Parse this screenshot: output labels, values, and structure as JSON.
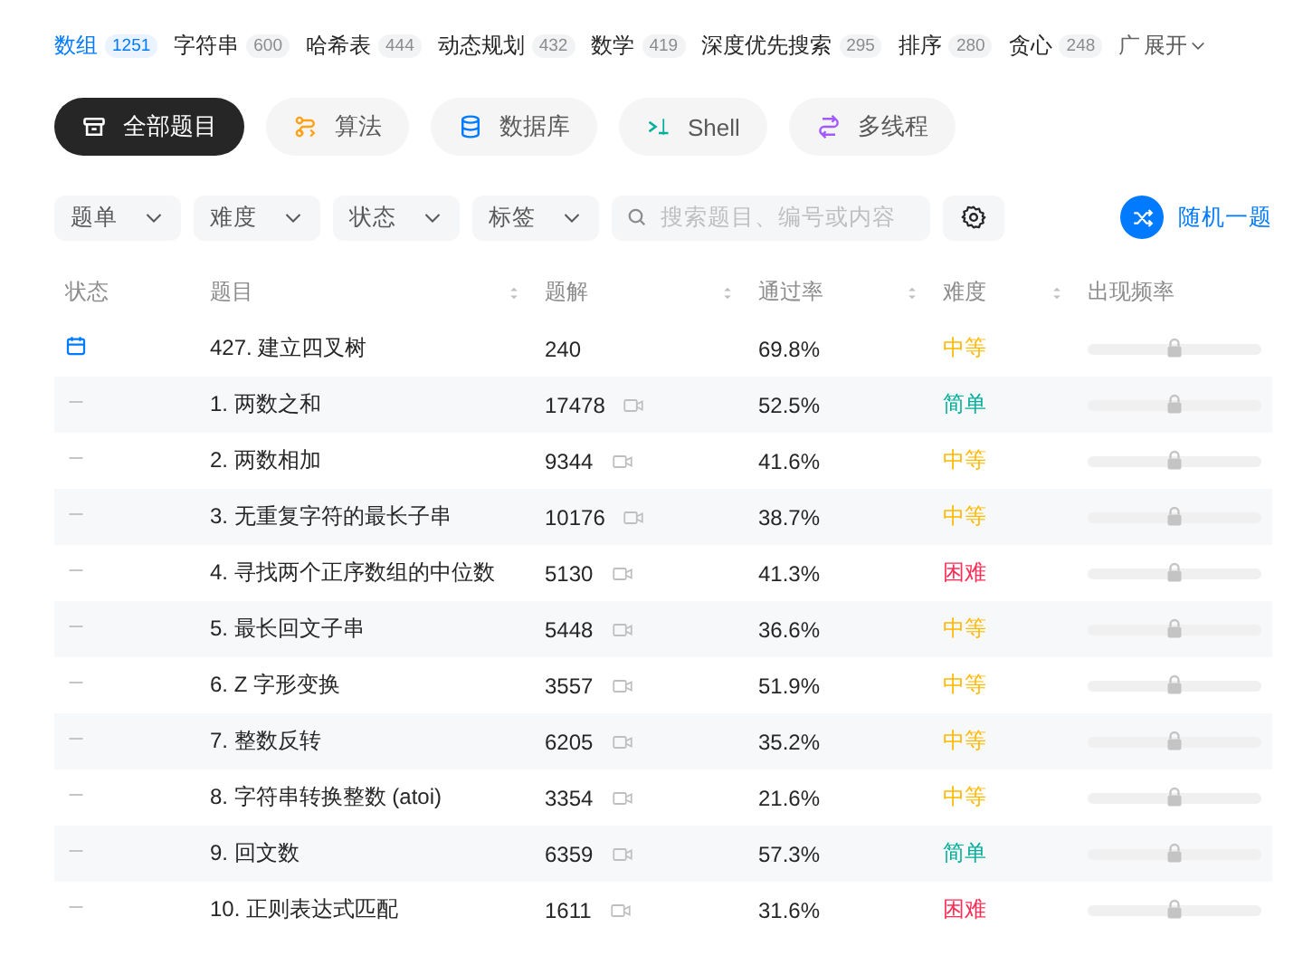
{
  "tags": [
    {
      "label": "数组",
      "count": "1251",
      "selected": true
    },
    {
      "label": "字符串",
      "count": "600",
      "selected": false
    },
    {
      "label": "哈希表",
      "count": "444",
      "selected": false
    },
    {
      "label": "动态规划",
      "count": "432",
      "selected": false
    },
    {
      "label": "数学",
      "count": "419",
      "selected": false
    },
    {
      "label": "深度优先搜索",
      "count": "295",
      "selected": false
    },
    {
      "label": "排序",
      "count": "280",
      "selected": false
    },
    {
      "label": "贪心",
      "count": "248",
      "selected": false
    }
  ],
  "cut_tag": "广",
  "expand": "展开",
  "topics": [
    {
      "label": "全部题目",
      "kind": "all",
      "selected": true
    },
    {
      "label": "算法",
      "kind": "algorithm",
      "selected": false
    },
    {
      "label": "数据库",
      "kind": "database",
      "selected": false
    },
    {
      "label": "Shell",
      "kind": "shell",
      "selected": false
    },
    {
      "label": "多线程",
      "kind": "concurrency",
      "selected": false
    }
  ],
  "filters": [
    "题单",
    "难度",
    "状态",
    "标签"
  ],
  "search": {
    "placeholder": "搜索题目、编号或内容"
  },
  "random_button": "随机一题",
  "table": {
    "columns": [
      {
        "label": "状态",
        "sortable": false
      },
      {
        "label": "题目",
        "sortable": true
      },
      {
        "label": "题解",
        "sortable": true
      },
      {
        "label": "通过率",
        "sortable": true
      },
      {
        "label": "难度",
        "sortable": true
      },
      {
        "label": "出现频率",
        "sortable": false
      }
    ],
    "rows": [
      {
        "daily": true,
        "title": "427. 建立四叉树",
        "solutions": "240",
        "video": false,
        "acceptance": "69.8%",
        "difficulty": "中等",
        "kind": "medium"
      },
      {
        "daily": false,
        "title": "1. 两数之和",
        "solutions": "17478",
        "video": true,
        "acceptance": "52.5%",
        "difficulty": "简单",
        "kind": "easy"
      },
      {
        "daily": false,
        "title": "2. 两数相加",
        "solutions": "9344",
        "video": true,
        "acceptance": "41.6%",
        "difficulty": "中等",
        "kind": "medium"
      },
      {
        "daily": false,
        "title": "3. 无重复字符的最长子串",
        "solutions": "10176",
        "video": true,
        "acceptance": "38.7%",
        "difficulty": "中等",
        "kind": "medium"
      },
      {
        "daily": false,
        "title": "4. 寻找两个正序数组的中位数",
        "solutions": "5130",
        "video": true,
        "acceptance": "41.3%",
        "difficulty": "困难",
        "kind": "hard"
      },
      {
        "daily": false,
        "title": "5. 最长回文子串",
        "solutions": "5448",
        "video": true,
        "acceptance": "36.6%",
        "difficulty": "中等",
        "kind": "medium"
      },
      {
        "daily": false,
        "title": "6. Z 字形变换",
        "solutions": "3557",
        "video": true,
        "acceptance": "51.9%",
        "difficulty": "中等",
        "kind": "medium"
      },
      {
        "daily": false,
        "title": "7. 整数反转",
        "solutions": "6205",
        "video": true,
        "acceptance": "35.2%",
        "difficulty": "中等",
        "kind": "medium"
      },
      {
        "daily": false,
        "title": "8. 字符串转换整数 (atoi)",
        "solutions": "3354",
        "video": true,
        "acceptance": "21.6%",
        "difficulty": "中等",
        "kind": "medium"
      },
      {
        "daily": false,
        "title": "9. 回文数",
        "solutions": "6359",
        "video": true,
        "acceptance": "57.3%",
        "difficulty": "简单",
        "kind": "easy"
      },
      {
        "daily": false,
        "title": "10. 正则表达式匹配",
        "solutions": "1611",
        "video": true,
        "acceptance": "31.6%",
        "difficulty": "困难",
        "kind": "hard"
      }
    ]
  }
}
